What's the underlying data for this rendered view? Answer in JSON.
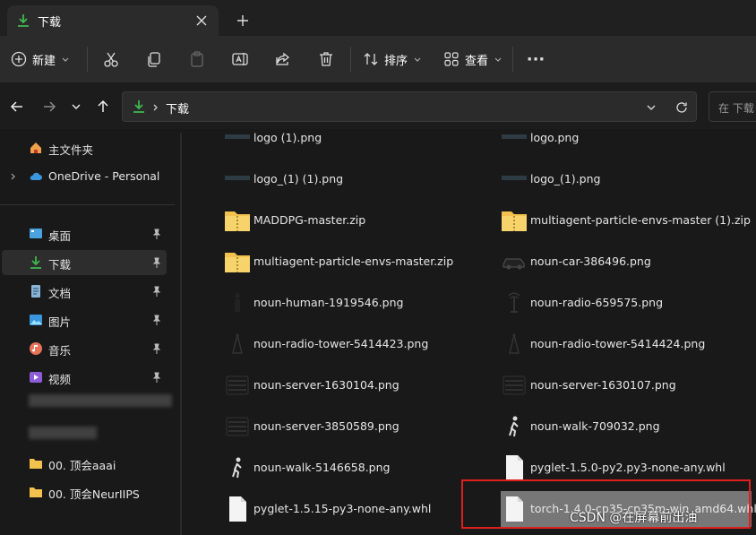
{
  "tab": {
    "title": "下载",
    "close": "✕",
    "new": "+"
  },
  "commands": {
    "new_label": "新建",
    "sort_label": "排序",
    "view_label": "查看",
    "more": "···"
  },
  "address": {
    "crumb": "下载",
    "search_placeholder": "在 下载"
  },
  "sidebar": {
    "items": [
      {
        "label": "主文件夹"
      },
      {
        "label": "OneDrive - Personal"
      },
      {
        "label": "桌面"
      },
      {
        "label": "下载"
      },
      {
        "label": "文档"
      },
      {
        "label": "图片"
      },
      {
        "label": "音乐"
      },
      {
        "label": "视频"
      },
      {
        "label": "00. 顶会aaai"
      },
      {
        "label": "00. 顶会NeurIIPS"
      }
    ]
  },
  "files": [
    {
      "name": "logo (1).png",
      "icon": "image-thumb"
    },
    {
      "name": "logo.png",
      "icon": "image-thumb"
    },
    {
      "name": "logo_(1) (1).png",
      "icon": "image-thumb"
    },
    {
      "name": "logo_(1).png",
      "icon": "image-thumb"
    },
    {
      "name": "MADDPG-master.zip",
      "icon": "zip-folder"
    },
    {
      "name": "multiagent-particle-envs-master (1).zip",
      "icon": "zip-folder"
    },
    {
      "name": "multiagent-particle-envs-master.zip",
      "icon": "zip-folder"
    },
    {
      "name": "noun-car-386496.png",
      "icon": "car-thumb"
    },
    {
      "name": "noun-human-1919546.png",
      "icon": "human-thumb"
    },
    {
      "name": "noun-radio-659575.png",
      "icon": "radio-thumb"
    },
    {
      "name": "noun-radio-tower-5414423.png",
      "icon": "tower-thumb"
    },
    {
      "name": "noun-radio-tower-5414424.png",
      "icon": "tower-thumb"
    },
    {
      "name": "noun-server-1630104.png",
      "icon": "server-thumb"
    },
    {
      "name": "noun-server-1630107.png",
      "icon": "server-thumb"
    },
    {
      "name": "noun-server-3850589.png",
      "icon": "server-thumb"
    },
    {
      "name": "noun-walk-709032.png",
      "icon": "walk-thumb"
    },
    {
      "name": "noun-walk-5146658.png",
      "icon": "walk-thumb"
    },
    {
      "name": "pyglet-1.5.0-py2.py3-none-any.whl",
      "icon": "file-doc"
    },
    {
      "name": "pyglet-1.5.15-py3-none-any.whl",
      "icon": "file-doc"
    },
    {
      "name": "torch-1.4.0-cp35-cp35m-win_amd64.whl",
      "icon": "file-doc"
    }
  ],
  "watermark": "CSDN @在屏幕前出油",
  "colors": {
    "accent": "#4cc2ff",
    "download_green": "#3fb950",
    "highlight_red": "#e01e1e",
    "selection": "#777777"
  }
}
